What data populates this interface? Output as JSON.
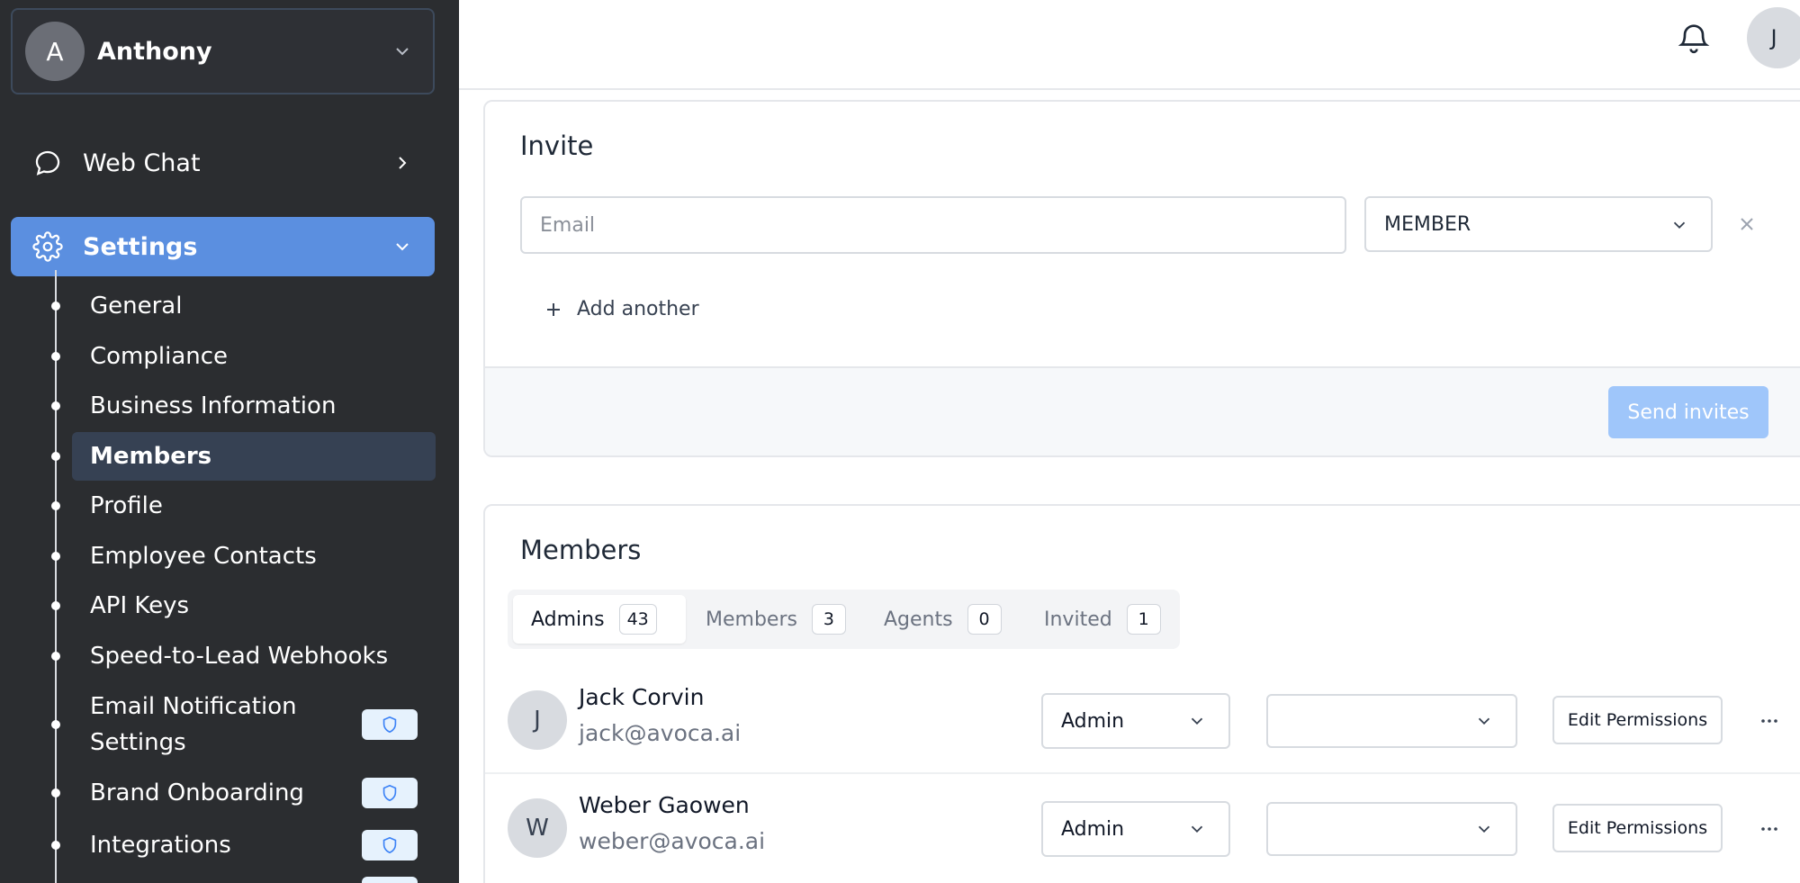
{
  "sidebar": {
    "account": {
      "initial": "A",
      "name": "Anthony"
    },
    "nav": [
      {
        "label": "Web Chat"
      },
      {
        "label": "Settings"
      }
    ],
    "settings_items": [
      {
        "label": "General"
      },
      {
        "label": "Compliance"
      },
      {
        "label": "Business Information"
      },
      {
        "label": "Members"
      },
      {
        "label": "Profile"
      },
      {
        "label": "Employee Contacts"
      },
      {
        "label": "API Keys"
      },
      {
        "label": "Speed-to-Lead Webhooks"
      },
      {
        "label": "Email Notification Settings"
      },
      {
        "label": "Brand Onboarding"
      },
      {
        "label": "Integrations"
      }
    ]
  },
  "topbar": {
    "user_initial": "J"
  },
  "invite": {
    "title": "Invite",
    "email_placeholder": "Email",
    "role_value": "MEMBER",
    "add_another": "Add another",
    "send_button": "Send invites"
  },
  "members": {
    "title": "Members",
    "tabs": [
      {
        "label": "Admins",
        "count": "43"
      },
      {
        "label": "Members",
        "count": "3"
      },
      {
        "label": "Agents",
        "count": "0"
      },
      {
        "label": "Invited",
        "count": "1"
      }
    ],
    "rows": [
      {
        "initial": "J",
        "name": "Jack Corvin",
        "email": "jack@avoca.ai",
        "role": "Admin",
        "second": "",
        "edit": "Edit Permissions"
      },
      {
        "initial": "W",
        "name": "Weber Gaowen",
        "email": "weber@avoca.ai",
        "role": "Admin",
        "second": "",
        "edit": "Edit Permissions"
      }
    ]
  },
  "colors": {
    "sidebar_bg": "#2b2d30",
    "settings_active": "#5b8fe0",
    "subitem_active": "#364153",
    "send_button": "#9fc6fa"
  },
  "icons": [
    "chevron-down-icon",
    "chat-bubble-icon",
    "chevron-right-icon",
    "gear-icon",
    "shield-icon",
    "bell-icon",
    "close-icon",
    "plus-icon",
    "more-horizontal-icon"
  ]
}
